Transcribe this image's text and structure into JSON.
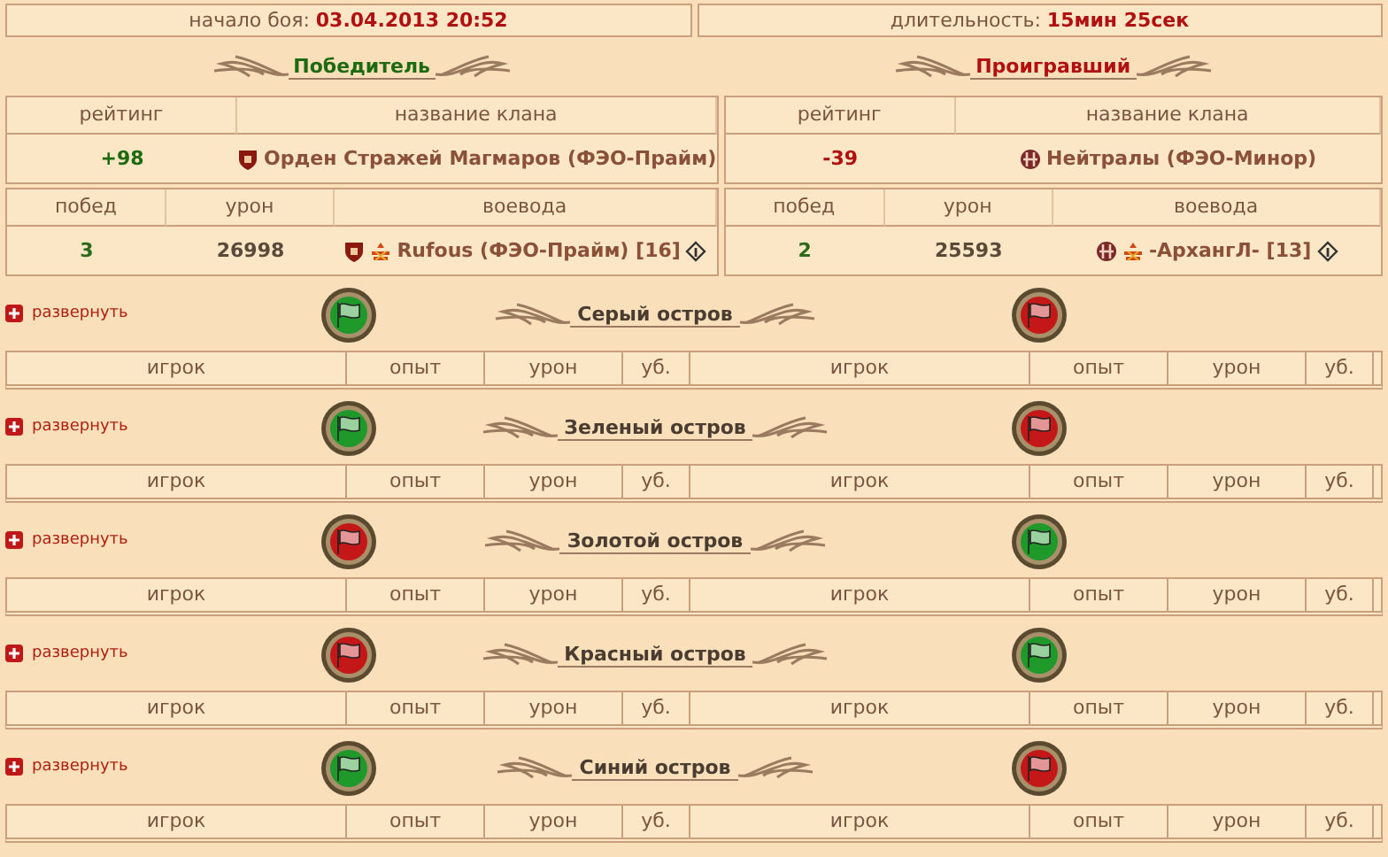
{
  "battle_info": {
    "start_label": "начало боя:",
    "start": "03.04.2013 20:52",
    "duration_label": "длительность:",
    "duration": "15мин 25сек"
  },
  "sides": [
    {
      "kind": "winner",
      "result": "Победитель",
      "rating_header": "рейтинг",
      "clan_header": "название клана",
      "rating": "+98",
      "clan": "Орден Стражей Магмаров (ФЭО-Прайм)",
      "wins_header": "побед",
      "damage_header": "урон",
      "leader_header": "воевода",
      "wins": "3",
      "damage": "26998",
      "leader": "Rufous (ФЭО-Прайм) [16]"
    },
    {
      "kind": "loser",
      "result": "Проигравший",
      "rating_header": "рейтинг",
      "clan_header": "название клана",
      "rating": "-39",
      "clan": "Нейтралы (ФЭО-Минор)",
      "wins_header": "побед",
      "damage_header": "урон",
      "leader_header": "воевода",
      "wins": "2",
      "damage": "25593",
      "leader": "-АрхангЛ- [13]"
    }
  ],
  "islands": [
    {
      "expand": "развернуть",
      "title": "Серый остров",
      "flags": [
        {
          "kind": "green"
        },
        {
          "kind": "red"
        }
      ],
      "columns": [
        "игрок",
        "опыт",
        "урон",
        "уб.",
        "игрок",
        "опыт",
        "урон",
        "уб."
      ]
    },
    {
      "expand": "развернуть",
      "title": "Зеленый остров",
      "flags": [
        {
          "kind": "green"
        },
        {
          "kind": "red"
        }
      ],
      "columns": [
        "игрок",
        "опыт",
        "урон",
        "уб.",
        "игрок",
        "опыт",
        "урон",
        "уб."
      ]
    },
    {
      "expand": "развернуть",
      "title": "Золотой остров",
      "flags": [
        {
          "kind": "red"
        },
        {
          "kind": "green"
        }
      ],
      "columns": [
        "игрок",
        "опыт",
        "урон",
        "уб.",
        "игрок",
        "опыт",
        "урон",
        "уб."
      ]
    },
    {
      "expand": "развернуть",
      "title": "Красный остров",
      "flags": [
        {
          "kind": "red"
        },
        {
          "kind": "green"
        }
      ],
      "columns": [
        "игрок",
        "опыт",
        "урон",
        "уб.",
        "игрок",
        "опыт",
        "урон",
        "уб."
      ]
    },
    {
      "expand": "развернуть",
      "title": "Синий остров",
      "flags": [
        {
          "kind": "green"
        },
        {
          "kind": "red"
        }
      ],
      "columns": [
        "игрок",
        "опыт",
        "урон",
        "уб.",
        "игрок",
        "опыт",
        "урон",
        "уб."
      ]
    }
  ]
}
